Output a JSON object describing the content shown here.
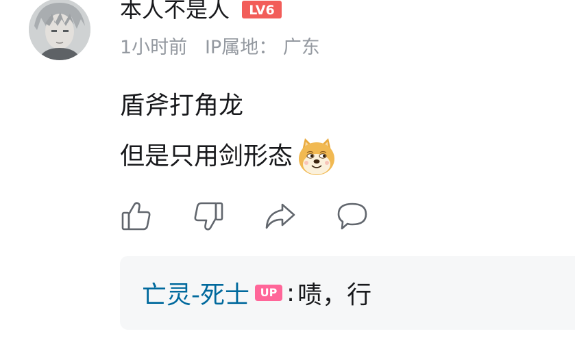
{
  "comment": {
    "username": "本人不是人",
    "level_badge": "LV6",
    "meta": {
      "time": "1小时前",
      "ip_label": "IP属地：",
      "ip_location": "广东"
    },
    "content_lines": [
      "盾斧打角龙",
      "但是只用剑形态"
    ],
    "emoji": "doge-icon",
    "actions": [
      "thumbs-up-icon",
      "thumbs-down-icon",
      "share-icon",
      "comment-icon"
    ],
    "reply": {
      "author": "亡灵-死士",
      "badge": "UP",
      "colon": ":",
      "text": "啧，行"
    }
  },
  "colors": {
    "username": "#18191c",
    "meta": "#9499a0",
    "reply_author": "#00699d",
    "up_badge": "#ff6699",
    "level_badge": "#f25d59",
    "reply_bg": "#f6f7f8"
  }
}
